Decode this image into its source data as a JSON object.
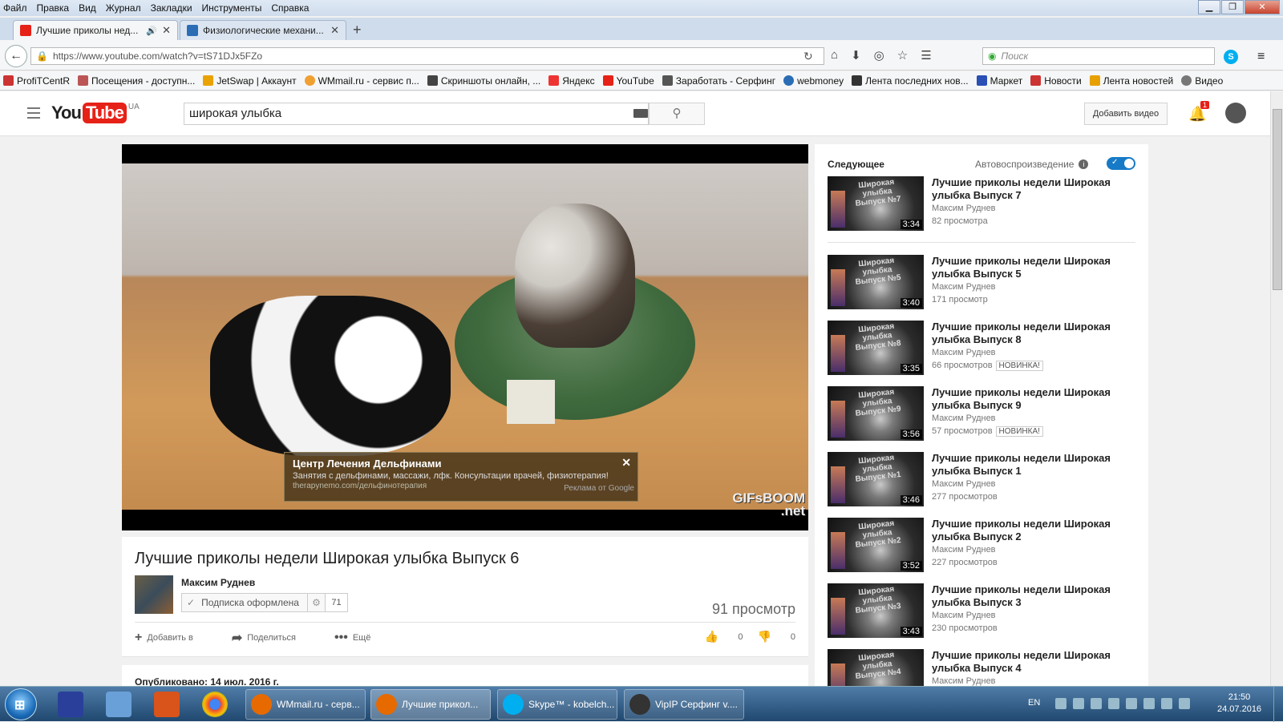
{
  "menu": [
    "Файл",
    "Правка",
    "Вид",
    "Журнал",
    "Закладки",
    "Инструменты",
    "Справка"
  ],
  "tabs": [
    {
      "label": "Лучшие приколы нед...",
      "active": true,
      "fav_color": "#e62117"
    },
    {
      "label": "Физиологические механи...",
      "active": false,
      "fav_color": "#2a6db5"
    }
  ],
  "nav": {
    "url": "https://www.youtube.com/watch?v=tS71DJx5FZo",
    "search_placeholder": "Поиск"
  },
  "bookmarks": [
    {
      "label": "ProfiTCentR",
      "color": "#c33"
    },
    {
      "label": "Посещения - доступн...",
      "color": "#b55"
    },
    {
      "label": "JetSwap | Аккаунт",
      "color": "#e9a200"
    },
    {
      "label": "WMmail.ru - сервис п...",
      "color": "#f0a030"
    },
    {
      "label": "Скриншоты онлайн, ...",
      "color": "#444"
    },
    {
      "label": "Яндекс",
      "color": "#e33"
    },
    {
      "label": "YouTube",
      "color": "#e62117"
    },
    {
      "label": "Заработать - Серфинг",
      "color": "#555"
    },
    {
      "label": "webmoney",
      "color": "#2a6db5"
    },
    {
      "label": "Лента последних нов...",
      "color": "#333"
    },
    {
      "label": "Маркет",
      "color": "#2a4fb5"
    },
    {
      "label": "Новости",
      "color": "#c33"
    },
    {
      "label": "Лента новостей",
      "color": "#e8a000"
    },
    {
      "label": "Видео",
      "color": "#777"
    }
  ],
  "yt": {
    "logo_you": "You",
    "logo_tube": "Tube",
    "region": "UA",
    "search_value": "широкая улыбка",
    "upload_label": "Добавить видео",
    "notif_count": "1"
  },
  "player": {
    "watermark_line1": "GIFsBOOM",
    "watermark_line2": ".net",
    "ad_title": "Центр Лечения Дельфинами",
    "ad_desc": "Занятия с дельфинами, массажи, лфк. Консультации врачей, физиотерапия!",
    "ad_url": "therapynemo.com/дельфинотерапия",
    "ad_by": "Реклама от Google"
  },
  "video": {
    "title": "Лучшие приколы недели Широкая улыбка Выпуск 6",
    "channel": "Максим Руднев",
    "subscribed_label": "Подписка оформлена",
    "sub_count": "71",
    "views": "91 просмотр",
    "add_label": "Добавить в",
    "share_label": "Поделиться",
    "more_label": "Ещё",
    "likes": "0",
    "dislikes": "0",
    "published": "Опубликовано: 14 июл. 2016 г."
  },
  "sidebar": {
    "next_label": "Следующее",
    "autoplay_label": "Автовоспроизведение",
    "items": [
      {
        "title": "Лучшие приколы недели Широкая улыбка Выпуск 7",
        "channel": "Максим Руднев",
        "views": "82 просмотра",
        "duration": "3:34",
        "thumb_label": "Широкая улыбка Выпуск №7",
        "new": ""
      },
      {
        "title": "Лучшие приколы недели Широкая улыбка Выпуск 5",
        "channel": "Максим Руднев",
        "views": "171 просмотр",
        "duration": "3:40",
        "thumb_label": "Широкая улыбка Выпуск №5",
        "new": ""
      },
      {
        "title": "Лучшие приколы недели Широкая улыбка Выпуск 8",
        "channel": "Максим Руднев",
        "views": "66 просмотров",
        "duration": "3:35",
        "thumb_label": "Широкая улыбка Выпуск №8",
        "new": "НОВИНКА!"
      },
      {
        "title": "Лучшие приколы недели Широкая улыбка Выпуск 9",
        "channel": "Максим Руднев",
        "views": "57 просмотров",
        "duration": "3:56",
        "thumb_label": "Широкая улыбка Выпуск №9",
        "new": "НОВИНКА!"
      },
      {
        "title": "Лучшие приколы недели Широкая улыбка Выпуск 1",
        "channel": "Максим Руднев",
        "views": "277 просмотров",
        "duration": "3:46",
        "thumb_label": "Широкая улыбка Выпуск №1",
        "new": ""
      },
      {
        "title": "Лучшие приколы недели Широкая улыбка Выпуск 2",
        "channel": "Максим Руднев",
        "views": "227 просмотров",
        "duration": "3:52",
        "thumb_label": "Широкая улыбка Выпуск №2",
        "new": ""
      },
      {
        "title": "Лучшие приколы недели Широкая улыбка Выпуск 3",
        "channel": "Максим Руднев",
        "views": "230 просмотров",
        "duration": "3:43",
        "thumb_label": "Широкая улыбка Выпуск №3",
        "new": ""
      },
      {
        "title": "Лучшие приколы недели Широкая улыбка Выпуск 4",
        "channel": "Максим Руднев",
        "views": "",
        "duration": "",
        "thumb_label": "Широкая улыбка Выпуск №4",
        "new": ""
      }
    ]
  },
  "taskbar": {
    "tasks": [
      {
        "label": "WMmail.ru - серв...",
        "color": "#e66a00"
      },
      {
        "label": "Лучшие прикол...",
        "color": "#e66a00"
      },
      {
        "label": "Skype™ - kobelch...",
        "color": "#00aff0"
      },
      {
        "label": "VipIP Серфинг  v....",
        "color": "#333"
      }
    ],
    "lang": "EN",
    "time": "21:50",
    "date": "24.07.2016"
  }
}
